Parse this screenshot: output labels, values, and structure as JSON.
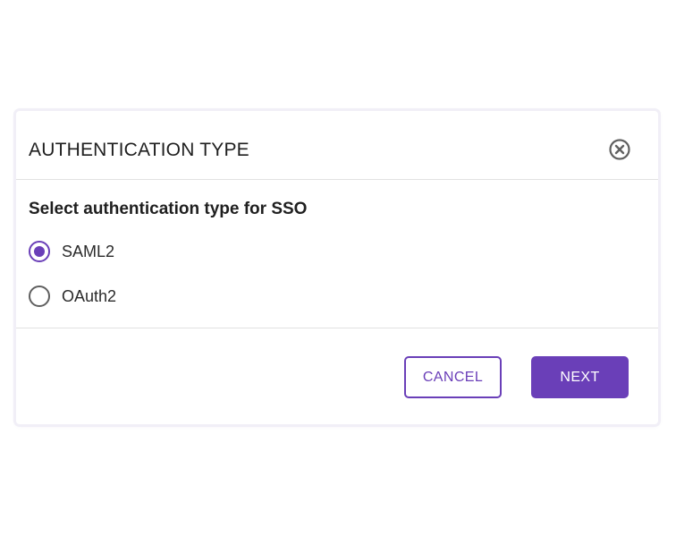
{
  "dialog": {
    "title": "AUTHENTICATION TYPE",
    "close_icon": "close-circle-icon",
    "prompt": "Select authentication type for SSO",
    "options": [
      {
        "label": "SAML2",
        "selected": true
      },
      {
        "label": "OAuth2",
        "selected": false
      }
    ],
    "buttons": {
      "cancel_label": "CANCEL",
      "next_label": "NEXT"
    }
  },
  "colors": {
    "accent": "#6a3fb8",
    "text": "#1f1f1f",
    "divider": "#e2e2e2"
  }
}
